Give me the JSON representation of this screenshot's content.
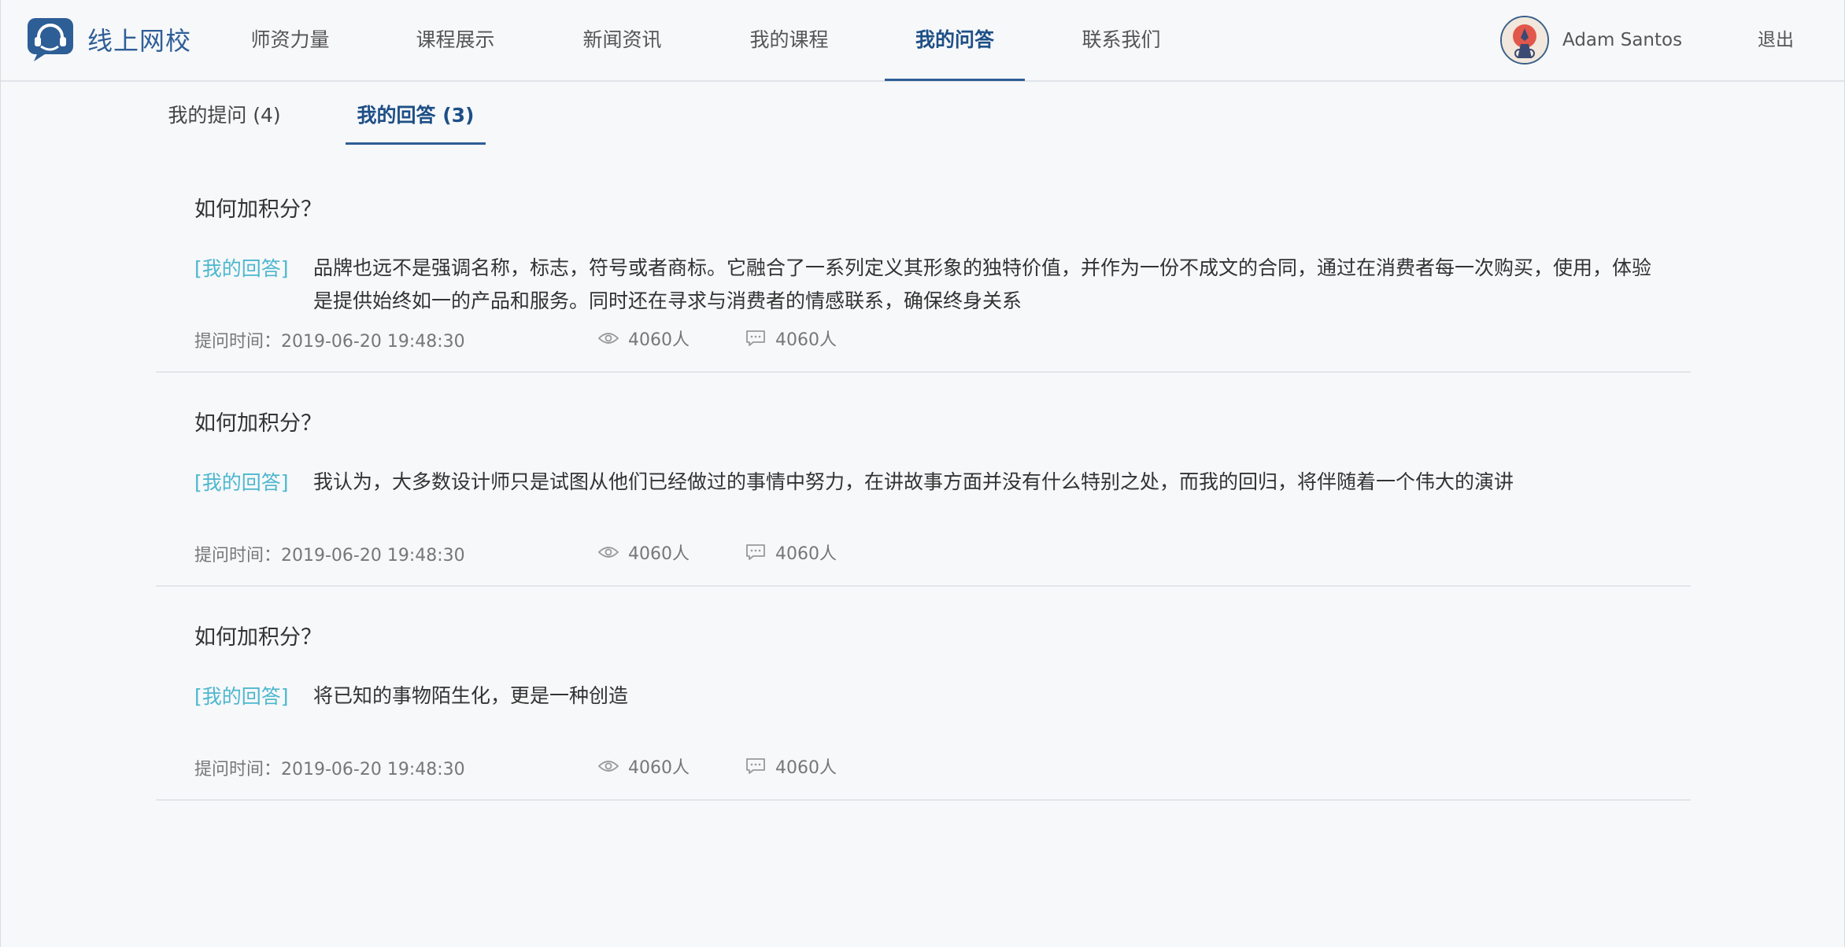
{
  "brand": {
    "name": "线上网校",
    "accent": "#2e5e96",
    "tag_color": "#4cb7cf"
  },
  "nav": {
    "items": [
      {
        "label": "师资力量",
        "active": false
      },
      {
        "label": "课程展示",
        "active": false
      },
      {
        "label": "新闻资讯",
        "active": false
      },
      {
        "label": "我的课程",
        "active": false
      },
      {
        "label": "我的问答",
        "active": true
      },
      {
        "label": "联系我们",
        "active": false
      }
    ]
  },
  "user": {
    "name": "Adam Santos",
    "logout_label": "退出"
  },
  "subtabs": [
    {
      "label": "我的提问 (4)",
      "active": false
    },
    {
      "label": "我的回答 (3)",
      "active": true
    }
  ],
  "answers": [
    {
      "title": "如何加积分？",
      "tag": "[我的回答]",
      "text": "品牌也远不是强调名称，标志，符号或者商标。它融合了一系列定义其形象的独特价值，并作为一份不成文的合同，通过在消费者每一次购买，使用，体验是提供始终如一的产品和服务。同时还在寻求与消费者的情感联系，确保终身关系",
      "time": "提问时间：2019-06-20  19:48:30",
      "views": "4060人",
      "comments": "4060人"
    },
    {
      "title": "如何加积分？",
      "tag": "[我的回答]",
      "text": "我认为，大多数设计师只是试图从他们已经做过的事情中努力，在讲故事方面并没有什么特别之处，而我的回归，将伴随着一个伟大的演讲",
      "time": "提问时间：2019-06-20  19:48:30",
      "views": "4060人",
      "comments": "4060人"
    },
    {
      "title": "如何加积分？",
      "tag": "[我的回答]",
      "text": "将已知的事物陌生化，更是一种创造",
      "time": "提问时间：2019-06-20  19:48:30",
      "views": "4060人",
      "comments": "4060人"
    }
  ],
  "icons": {
    "logo": "chat-bubble-headset-icon",
    "views": "eye-icon",
    "comments": "comment-icon"
  }
}
